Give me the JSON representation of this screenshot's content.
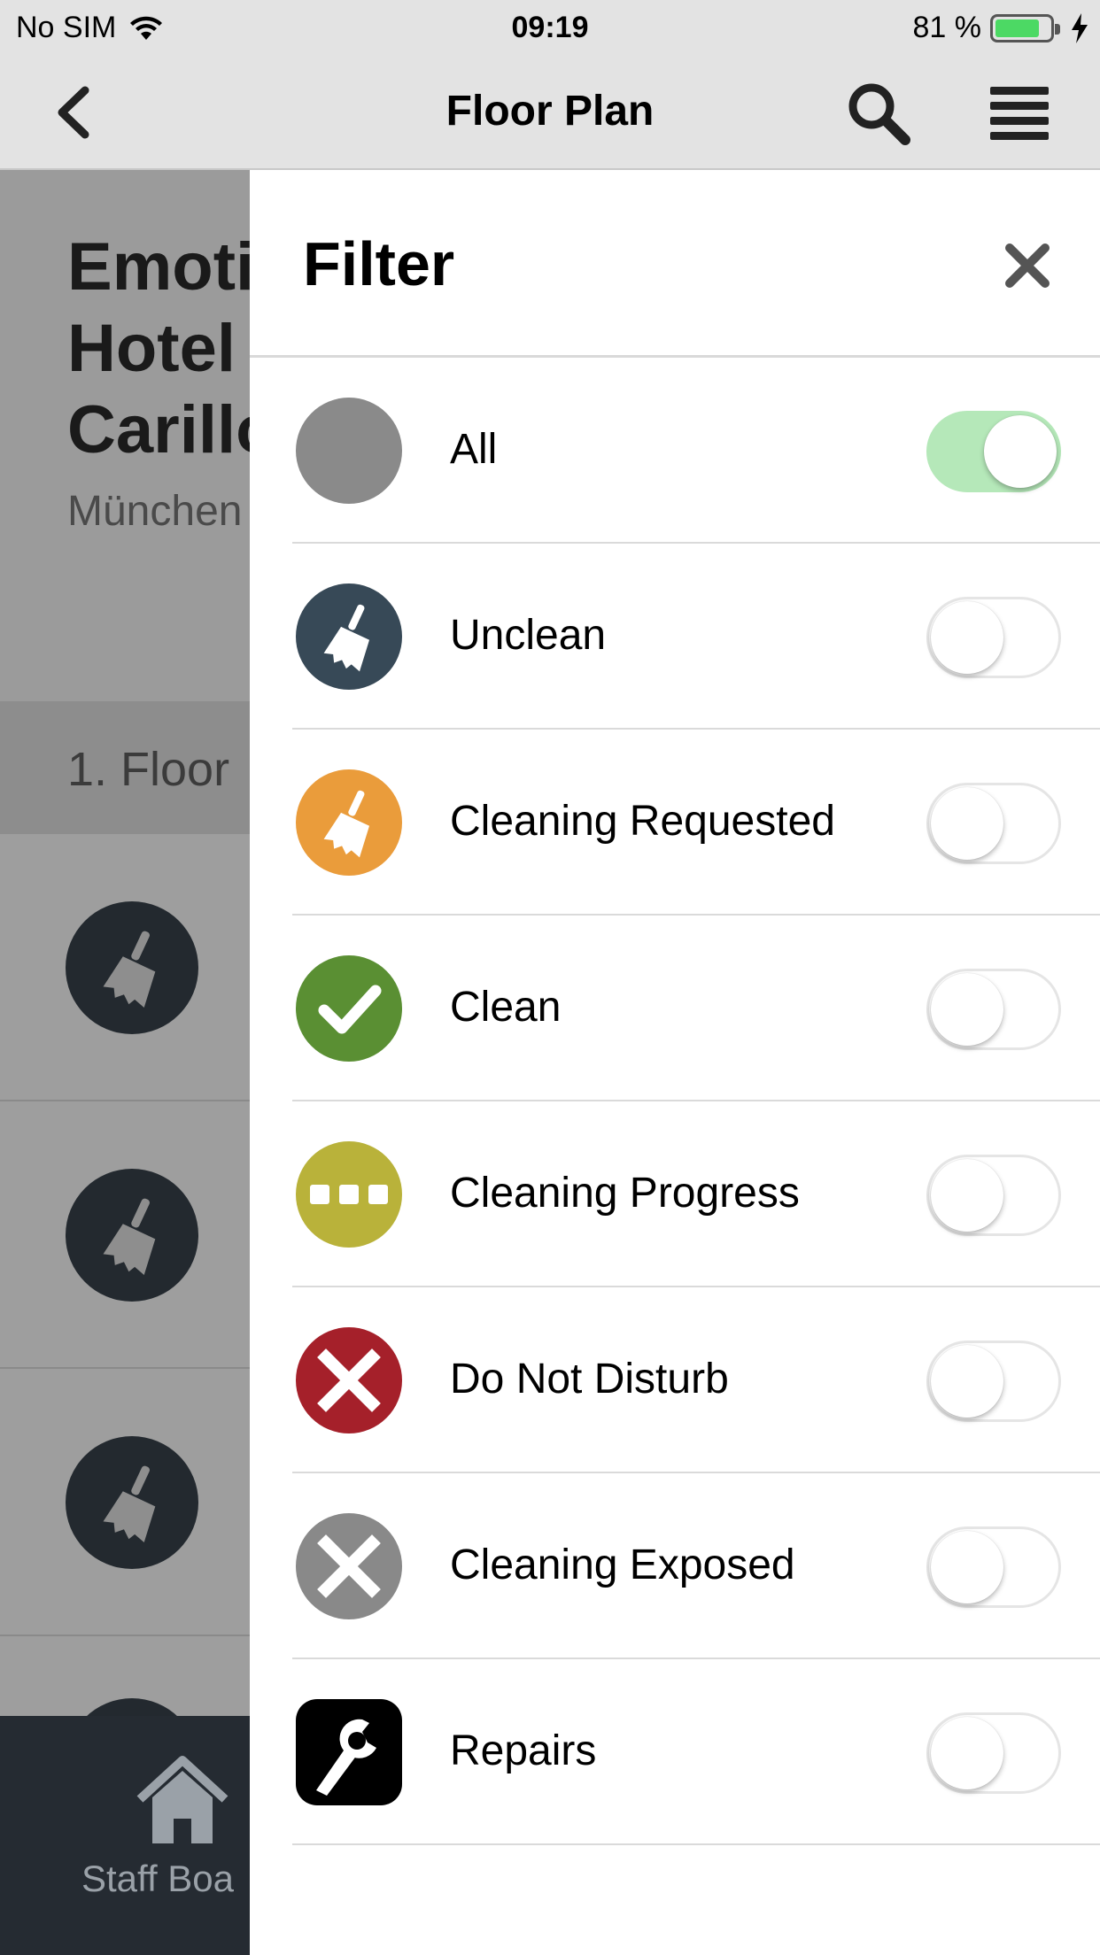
{
  "status_bar": {
    "carrier": "No SIM",
    "time": "09:19",
    "battery_percent": "81 %",
    "battery_level": 0.81,
    "icons": [
      "wifi-icon",
      "battery-icon",
      "charging-icon"
    ]
  },
  "nav": {
    "title": "Floor Plan",
    "icons": [
      "chevron-left-icon",
      "search-icon",
      "menu-icon"
    ]
  },
  "background": {
    "hotel_name_lines": [
      "Emoti",
      "Hotel",
      "Carillo"
    ],
    "city": "München",
    "floor": "1. Floor",
    "tab_label": "Staff Boa"
  },
  "filter": {
    "title": "Filter",
    "items": [
      {
        "label": "All",
        "icon": "circle-icon",
        "color": "#8a8a8a",
        "enabled": true
      },
      {
        "label": "Unclean",
        "icon": "broom-icon",
        "color": "#374957",
        "enabled": false
      },
      {
        "label": "Cleaning Requested",
        "icon": "broom-icon",
        "color": "#ea9c3b",
        "enabled": false
      },
      {
        "label": "Clean",
        "icon": "check-icon",
        "color": "#5a8f33",
        "enabled": false
      },
      {
        "label": "Cleaning Progress",
        "icon": "dots-icon",
        "color": "#b9b23a",
        "enabled": false
      },
      {
        "label": "Do Not Disturb",
        "icon": "x-icon",
        "color": "#a5202a",
        "enabled": false
      },
      {
        "label": "Cleaning Exposed",
        "icon": "x-icon",
        "color": "#898989",
        "enabled": false
      },
      {
        "label": "Repairs",
        "icon": "wrench-icon",
        "color": "#000000",
        "enabled": false
      }
    ]
  },
  "colors": {
    "toggle_on": "#b5e8b9",
    "bar_background": "#e3e3e3",
    "tabbar": "#252b32"
  }
}
